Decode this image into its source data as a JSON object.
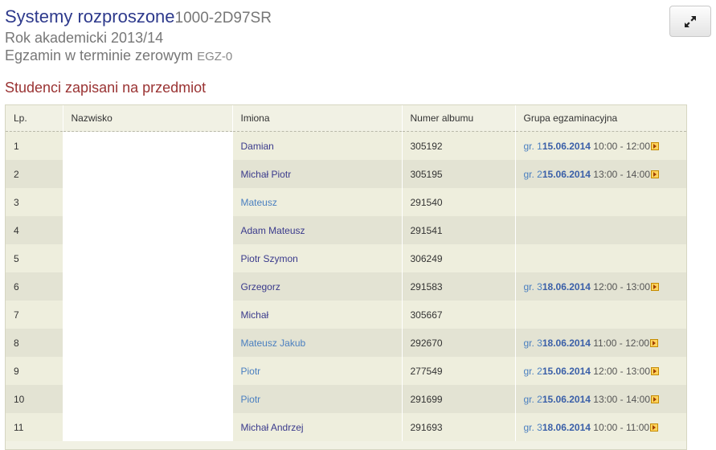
{
  "header": {
    "title": "Systemy rozproszone",
    "code": "1000-2D97SR",
    "year": "Rok akademicki 2013/14",
    "exam": "Egzamin w terminie zerowym",
    "exam_code": "EGZ-0"
  },
  "section_title": "Studenci zapisani na przedmiot",
  "table": {
    "columns": [
      "Lp.",
      "Nazwisko",
      "Imiona",
      "Numer albumu",
      "Grupa egzaminacyjna"
    ],
    "rows": [
      {
        "lp": "1",
        "imiona": "Damian",
        "album": "305192",
        "grupa_prefix": "gr. 1",
        "grupa_date": "15.06.2014",
        "grupa_time": "10:00 - 12:00"
      },
      {
        "lp": "2",
        "imiona": "Michał Piotr",
        "album": "305195",
        "grupa_prefix": "gr. 2",
        "grupa_date": "15.06.2014",
        "grupa_time": "13:00 - 14:00"
      },
      {
        "lp": "3",
        "imiona": "Mateusz",
        "album": "291540",
        "grupa_prefix": "",
        "grupa_date": "",
        "grupa_time": ""
      },
      {
        "lp": "4",
        "imiona": "Adam Mateusz",
        "album": "291541",
        "grupa_prefix": "",
        "grupa_date": "",
        "grupa_time": ""
      },
      {
        "lp": "5",
        "imiona": "Piotr Szymon",
        "album": "306249",
        "grupa_prefix": "",
        "grupa_date": "",
        "grupa_time": ""
      },
      {
        "lp": "6",
        "imiona": "Grzegorz",
        "album": "291583",
        "grupa_prefix": "gr. 3",
        "grupa_date": "18.06.2014",
        "grupa_time": "12:00 - 13:00"
      },
      {
        "lp": "7",
        "imiona": "Michał",
        "album": "305667",
        "grupa_prefix": "",
        "grupa_date": "",
        "grupa_time": ""
      },
      {
        "lp": "8",
        "imiona": "Mateusz Jakub",
        "album": "292670",
        "grupa_prefix": "gr. 3",
        "grupa_date": "18.06.2014",
        "grupa_time": "11:00 - 12:00"
      },
      {
        "lp": "9",
        "imiona": "Piotr",
        "album": "277549",
        "grupa_prefix": "gr. 2",
        "grupa_date": "15.06.2014",
        "grupa_time": "12:00 - 13:00"
      },
      {
        "lp": "10",
        "imiona": "Piotr",
        "album": "291699",
        "grupa_prefix": "gr. 2",
        "grupa_date": "15.06.2014",
        "grupa_time": "13:00 - 14:00"
      },
      {
        "lp": "11",
        "imiona": "Michał Andrzej",
        "album": "291693",
        "grupa_prefix": "gr. 3",
        "grupa_date": "18.06.2014",
        "grupa_time": "10:00 - 11:00"
      }
    ]
  },
  "icons": {
    "expand": "expand-arrows-icon",
    "group_link": "arrow-box-icon"
  },
  "colors": {
    "title": "#2e3a8c",
    "section": "#9a3333",
    "link": "#4a7fc0"
  }
}
